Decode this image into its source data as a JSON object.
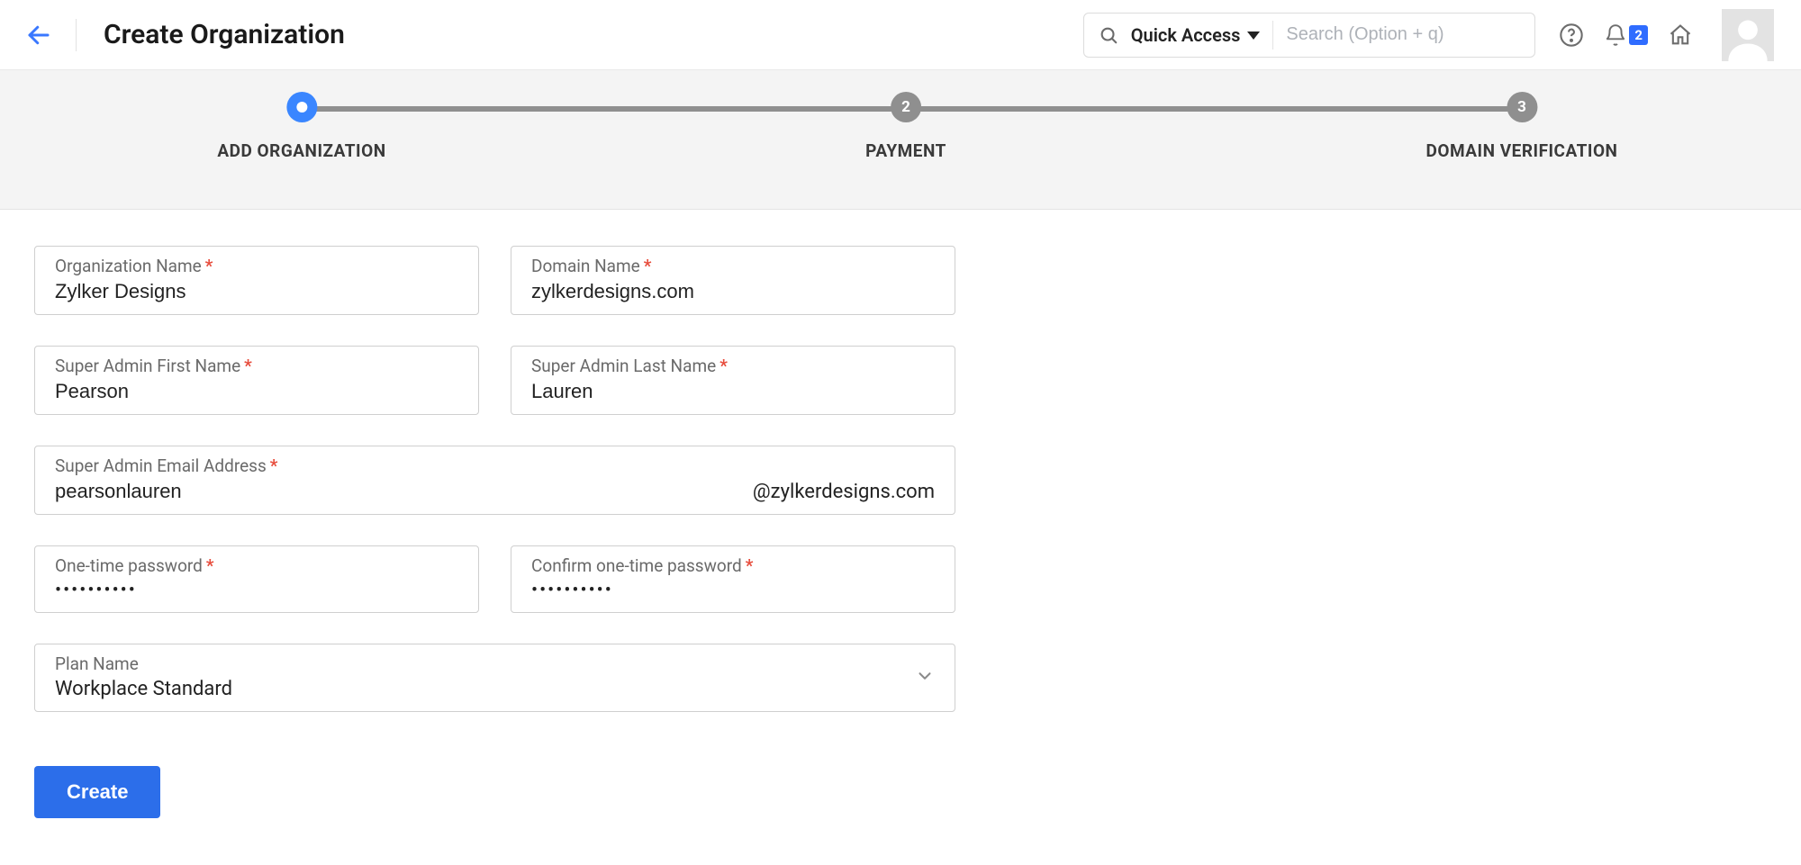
{
  "header": {
    "title": "Create Organization",
    "quick_access": "Quick Access",
    "search_placeholder": "Search (Option + q)",
    "notification_count": "2"
  },
  "stepper": {
    "steps": [
      {
        "num": "",
        "label": "ADD ORGANIZATION",
        "active": true
      },
      {
        "num": "2",
        "label": "PAYMENT",
        "active": false
      },
      {
        "num": "3",
        "label": "DOMAIN VERIFICATION",
        "active": false
      }
    ]
  },
  "form": {
    "org_name": {
      "label": "Organization Name",
      "value": "Zylker Designs",
      "required": true
    },
    "domain_name": {
      "label": "Domain Name",
      "value": "zylkerdesigns.com",
      "required": true
    },
    "first_name": {
      "label": "Super Admin First Name",
      "value": "Pearson",
      "required": true
    },
    "last_name": {
      "label": "Super Admin Last Name",
      "value": "Lauren",
      "required": true
    },
    "email": {
      "label": "Super Admin Email Address",
      "value": "pearsonlauren",
      "domain": "@zylkerdesigns.com",
      "required": true
    },
    "otp": {
      "label": "One-time password",
      "value": "••••••••••",
      "required": true
    },
    "otp_confirm": {
      "label": "Confirm one-time password",
      "value": "••••••••••",
      "required": true
    },
    "plan": {
      "label": "Plan Name",
      "value": "Workplace Standard",
      "required": false
    },
    "create_label": "Create"
  }
}
